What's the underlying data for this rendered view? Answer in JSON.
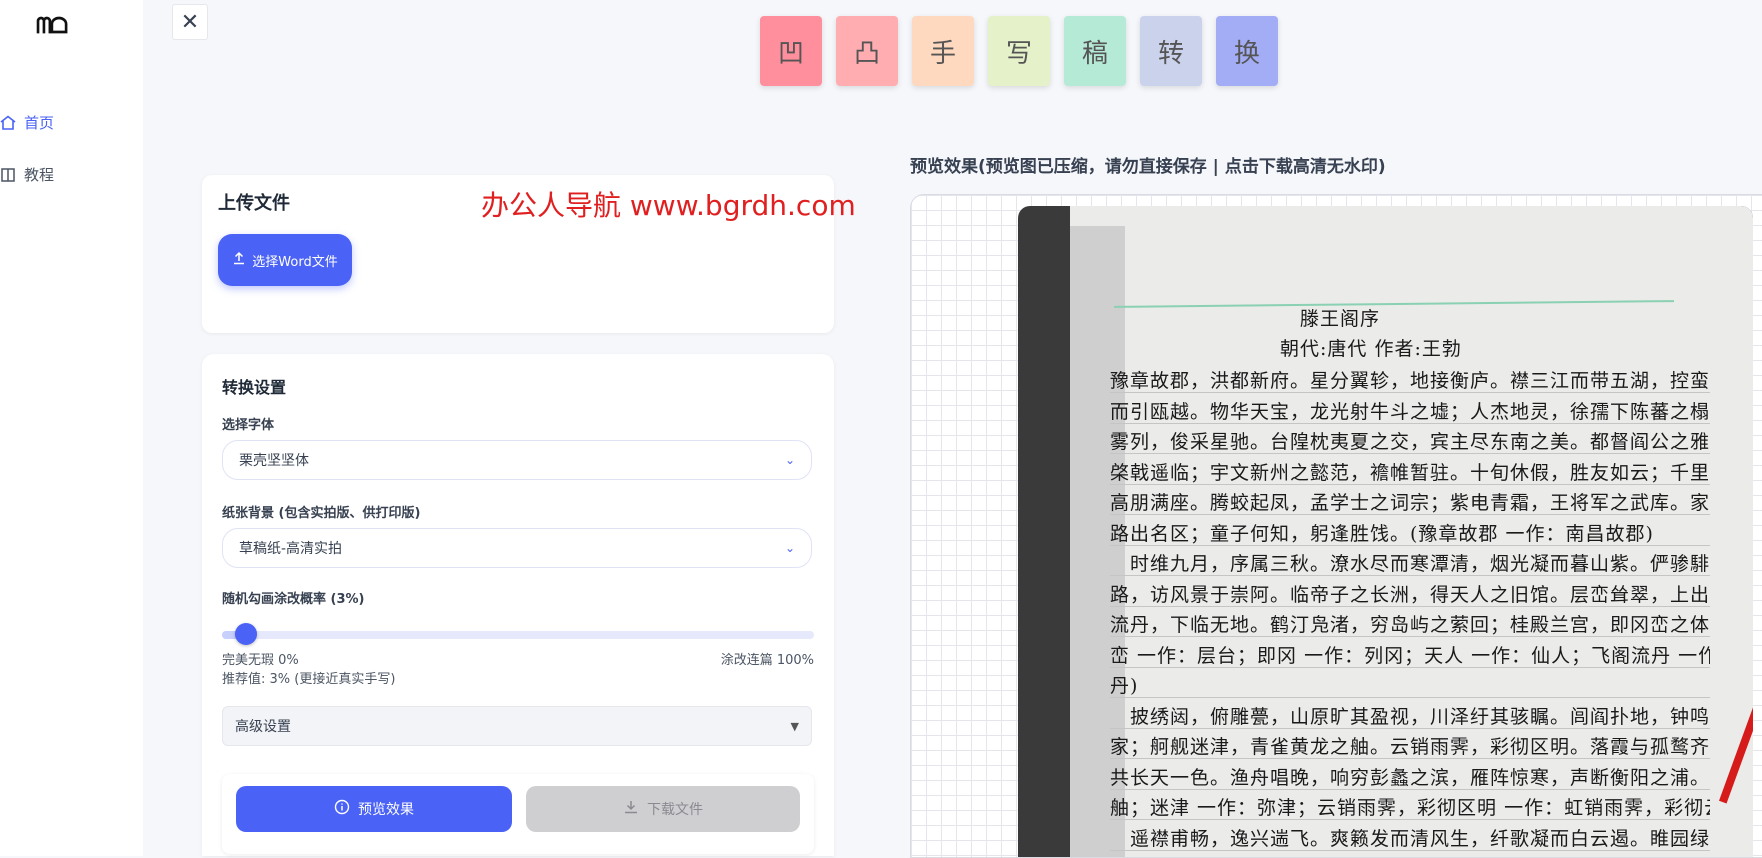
{
  "sidebar": {
    "logo": "ᗰᗝ",
    "items": [
      {
        "label": "首页",
        "icon": "home-icon",
        "active": true
      },
      {
        "label": "教程",
        "icon": "book-icon",
        "active": false
      }
    ]
  },
  "close": {
    "icon": "close-icon",
    "glyph": "✕"
  },
  "style_tiles": [
    {
      "glyph": "凹",
      "color": "#ff8f9c"
    },
    {
      "glyph": "凸",
      "color": "#ffadb0"
    },
    {
      "glyph": "手",
      "color": "#ffd9bf"
    },
    {
      "glyph": "写",
      "color": "#e5f1c9"
    },
    {
      "glyph": "稿",
      "color": "#b4ead6"
    },
    {
      "glyph": "转",
      "color": "#cbd2ec"
    },
    {
      "glyph": "换",
      "color": "#a3adf5"
    }
  ],
  "watermark": "办公人导航  www.bgrdh.com",
  "upload": {
    "title": "上传文件",
    "button_label": "选择Word文件"
  },
  "settings": {
    "title": "转换设置",
    "font_label": "选择字体",
    "font_value": "栗壳坚坚体",
    "paper_label": "纸张背景 (包含实拍版、供打印版)",
    "paper_value": "草稿纸-高清实拍",
    "probability_label": "随机勾画涂改概率 (3%)",
    "probability_value": 3,
    "min_label": "完美无瑕 0%",
    "max_label": "涂改连篇 100%",
    "recommend": "推荐值: 3% (更接近真实手写)",
    "advanced_label": "高级设置"
  },
  "actions": {
    "preview_label": "预览效果",
    "download_label": "下载文件"
  },
  "preview": {
    "title": "预览效果(预览图已压缩，请勿直接保存 | 点击下载高清无水印)",
    "handwriting": {
      "title": "滕王阁序",
      "subtitle": "朝代:唐代 作者:王勃",
      "lines": [
        "豫章故郡，洪都新府。星分翼轸，地接衡庐。襟三江而带五湖，控蛮荆",
        "而引瓯越。物华天宝，龙光射牛斗之墟；人杰地灵，徐孺下陈蕃之榻。雄州",
        "雾列，俊采星驰。台隍枕夷夏之交，宾主尽东南之美。都督阎公之雅望，",
        "棨戟遥临；宇文新州之懿范，襜帷暂驻。十旬休假，胜友如云；千里逢迎，",
        "高朋满座。腾蛟起凤，孟学士之词宗；紫电青霜，王将军之武库。家君作宰，",
        "路出名区；童子何知，躬逢胜饯。(豫章故郡 一作：南昌故郡)",
        "　时维九月，序属三秋。潦水尽而寒潭清，烟光凝而暮山紫。俨骖騑于上",
        "路，访风景于崇阿。临帝子之长洲，得天人之旧馆。层峦耸翠，上出重霄；飞阁",
        "流丹，下临无地。鹤汀凫渚，穷岛屿之萦回；桂殿兰宫，即冈峦之体势。(层",
        "峦 一作：层台；即冈 一作：列冈；天人 一作：仙人；飞阁流丹 一作：飞阁翔",
        "丹)",
        "　披绣闼，俯雕甍，山原旷其盈视，川泽纡其骇瞩。闾阎扑地，钟鸣鼎食之",
        "家；舸舰迷津，青雀黄龙之舳。云销雨霁，彩彻区明。落霞与孤鹜齐飞，秋水",
        "共长天一色。渔舟唱晚，响穷彭蠡之滨，雁阵惊寒，声断衡阳之浦。(轴 通：",
        "舳；迷津 一作：弥津；云销雨霁，彩彻区明 一作：虹销雨霁，彩彻云衢)",
        "　遥襟甫畅，逸兴遄飞。爽籁发而清风生，纤歌凝而白云遏。睢园绿竹，"
      ]
    }
  }
}
